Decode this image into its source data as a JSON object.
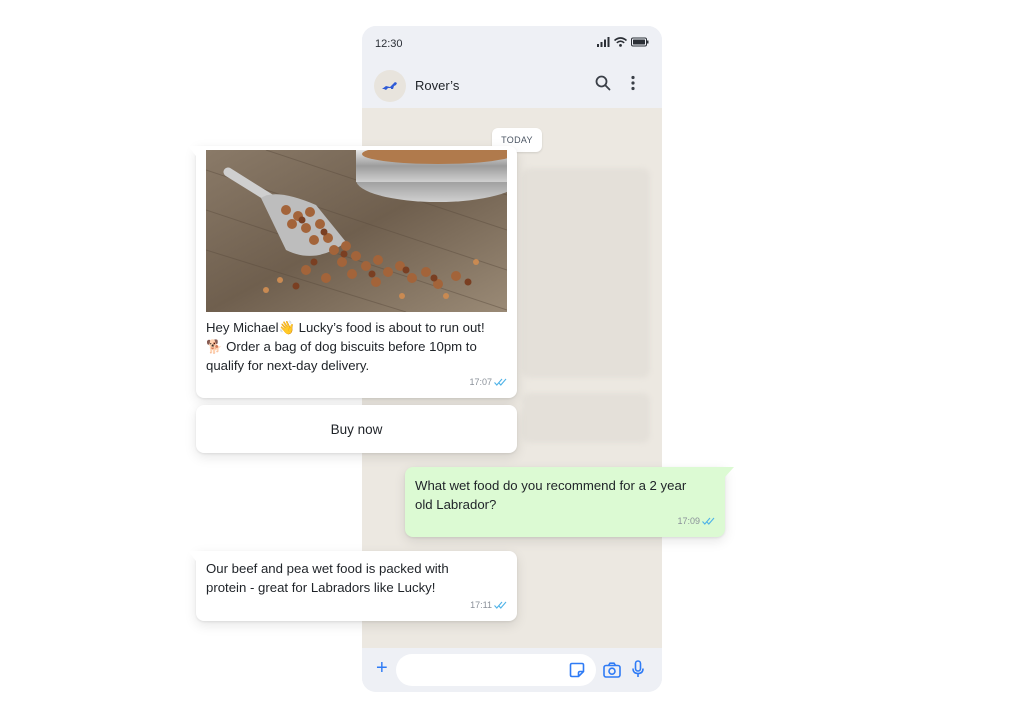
{
  "status_bar": {
    "time": "12:30"
  },
  "header": {
    "contact_name": "Rover’s"
  },
  "chat": {
    "date_divider": "TODAY",
    "messages": [
      {
        "direction": "incoming",
        "image": "dog food scoop and bowl",
        "lines": [
          "Hey Michael👋 Lucky’s food is about to run out!",
          "🐕 Order a bag of dog biscuits before 10pm to",
          "qualify for next-day delivery."
        ],
        "time": "17:07"
      },
      {
        "direction": "outgoing",
        "lines": [
          "What wet food do you recommend for a 2 year",
          "old Labrador?"
        ],
        "time": "17:09"
      },
      {
        "direction": "incoming",
        "lines": [
          "Our beef and pea wet food is packed with",
          "protein - great for Labradors like Lucky!"
        ],
        "time": "17:11"
      }
    ],
    "quick_reply_button": "Buy now"
  },
  "colors": {
    "accent": "#2f7bf5",
    "outgoing_bubble": "#dcfad3",
    "chat_background": "#ece8e1",
    "read_ticks": "#4fb3e8"
  },
  "icons": [
    "signal-icon",
    "wifi-icon",
    "battery-icon",
    "search-icon",
    "more-vert-icon",
    "plus-icon",
    "sticker-icon",
    "camera-icon",
    "mic-icon",
    "double-check-icon"
  ]
}
